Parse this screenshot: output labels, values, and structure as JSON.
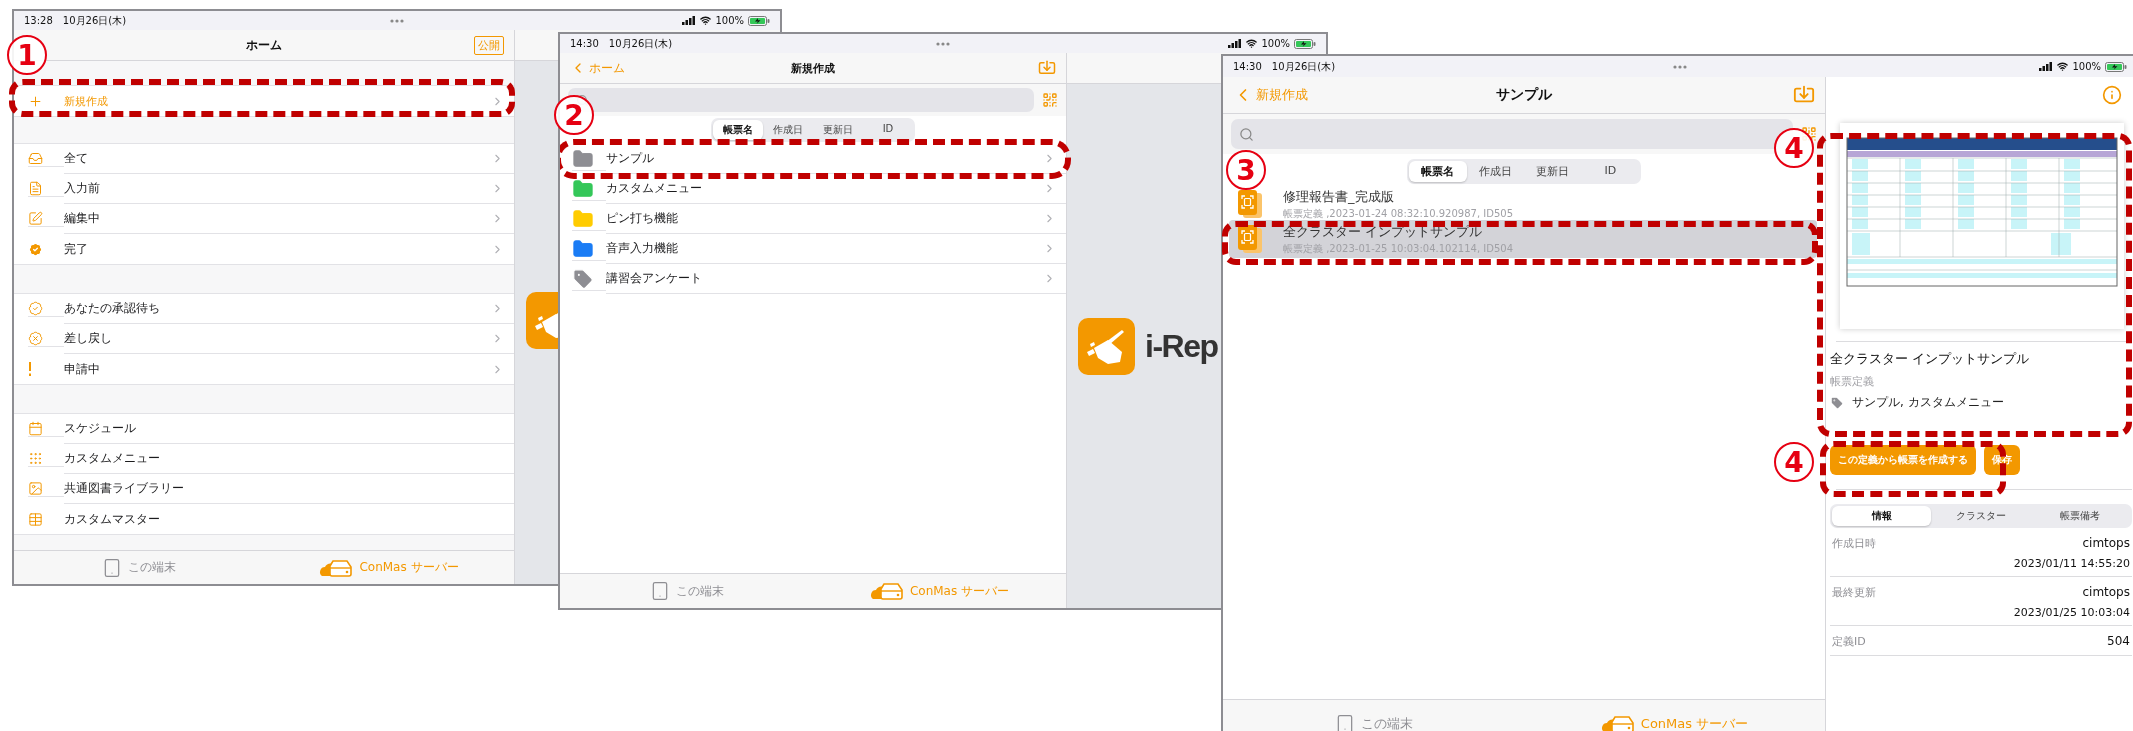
{
  "home_screen": {
    "status_bar": {
      "time": "13:28",
      "date": "10月26日(木)",
      "battery": "100%"
    },
    "nav": {
      "title": "ホーム",
      "action": "公開"
    },
    "menu_groups": [
      {
        "disclosure": true,
        "rows": [
          {
            "label": "新規作成",
            "kind": "action"
          }
        ]
      },
      {
        "disclosure": true,
        "rows": [
          {
            "label": "全て",
            "kind": "item"
          },
          {
            "label": "入力前",
            "kind": "item"
          },
          {
            "label": "編集中",
            "kind": "item"
          },
          {
            "label": "完了",
            "kind": "item"
          }
        ]
      },
      {
        "disclosure": true,
        "rows": [
          {
            "label": "あなたの承認待ち",
            "kind": "item"
          },
          {
            "label": "差し戻し",
            "kind": "item"
          },
          {
            "label": "申請中",
            "kind": "item"
          }
        ]
      },
      {
        "disclosure": false,
        "rows": [
          {
            "label": "スケジュール",
            "kind": "item"
          },
          {
            "label": "カスタムメニュー",
            "kind": "item"
          },
          {
            "label": "共通図書ライブラリー",
            "kind": "item"
          },
          {
            "label": "カスタムマスター",
            "kind": "item"
          }
        ]
      }
    ],
    "tab_bar": [
      {
        "label": "この端末",
        "selected": false
      },
      {
        "label": "ConMas サーバー",
        "selected": true
      }
    ]
  },
  "new_screen": {
    "status_bar": {
      "time": "14:30",
      "date": "10月26日(木)",
      "battery": "100%"
    },
    "nav": {
      "back": "ホーム",
      "title": "新規作成"
    },
    "sort_tabs": [
      {
        "label": "帳票名",
        "selected": true
      },
      {
        "label": "作成日",
        "selected": false
      },
      {
        "label": "更新日",
        "selected": false
      },
      {
        "label": "ID",
        "selected": false
      }
    ],
    "folders": [
      {
        "label": "サンプル",
        "kind": "folder",
        "color": "#8e8e93"
      },
      {
        "label": "カスタムメニュー",
        "kind": "folder",
        "color": "#34c759"
      },
      {
        "label": "ピン打ち機能",
        "kind": "folder",
        "color": "#ffcc00"
      },
      {
        "label": "音声入力機能",
        "kind": "folder",
        "color": "#1a7cf5"
      },
      {
        "label": "講習会アンケート",
        "kind": "tag",
        "color": "#8e8e93"
      }
    ],
    "brand_text": "i-Rep",
    "tab_bar": [
      {
        "label": "この端末",
        "selected": false
      },
      {
        "label": "ConMas サーバー",
        "selected": true
      }
    ]
  },
  "sample_screen": {
    "status_bar": {
      "time": "14:30",
      "date": "10月26日(木)",
      "battery": "100%"
    },
    "nav": {
      "back": "新規作成",
      "title": "サンプル"
    },
    "sort_tabs": [
      {
        "label": "帳票名",
        "selected": true
      },
      {
        "label": "作成日",
        "selected": false
      },
      {
        "label": "更新日",
        "selected": false
      },
      {
        "label": "ID",
        "selected": false
      }
    ],
    "forms": [
      {
        "title": "修理報告書_完成版",
        "subtitle": "帳票定義 ,2023-01-24 08:32:10.920987, ID505",
        "selected": false
      },
      {
        "title": "全クラスター インプットサンプル",
        "subtitle": "帳票定義 ,2023-01-25 10:03:04.102114, ID504",
        "selected": true
      }
    ],
    "detail": {
      "title": "全クラスター インプットサンプル",
      "type": "帳票定義",
      "tags": "サンプル, カスタムメニュー",
      "primary_button": "この定義から帳票を作成する",
      "secondary_button": "保存",
      "segments": [
        {
          "label": "情報",
          "selected": true
        },
        {
          "label": "クラスター",
          "selected": false
        },
        {
          "label": "帳票備考",
          "selected": false
        }
      ],
      "info_rows": [
        {
          "label": "作成日時",
          "value": "cimtops",
          "detail": "2023/01/11 14:55:20"
        },
        {
          "label": "最終更新",
          "value": "cimtops",
          "detail": "2023/01/25 10:03:04"
        },
        {
          "label": "定義ID",
          "value": "504"
        }
      ]
    },
    "tab_bar": [
      {
        "label": "この端末",
        "selected": false
      },
      {
        "label": "ConMas サーバー",
        "selected": true
      }
    ]
  },
  "annotations": [
    {
      "step": "1"
    },
    {
      "step": "2"
    },
    {
      "step": "3"
    },
    {
      "step": "4"
    },
    {
      "step": "4"
    }
  ]
}
